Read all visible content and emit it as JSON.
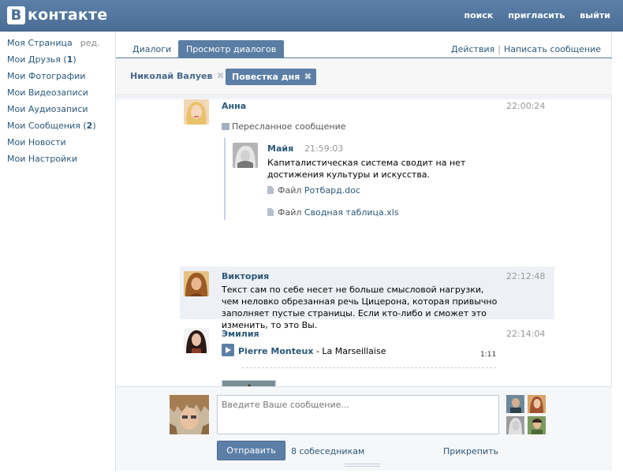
{
  "header": {
    "logo_letter": "В",
    "logo_text": "контакте",
    "links": [
      "поиск",
      "пригласить",
      "выйти"
    ]
  },
  "menu": {
    "items": [
      {
        "label": "Моя Страница",
        "extra": "ред."
      },
      {
        "label": "Мои Друзья (",
        "count": "1",
        "suffix": ")"
      },
      {
        "label": "Мои Фотографии"
      },
      {
        "label": "Мои Видеозаписи"
      },
      {
        "label": "Мои Аудиозаписи"
      },
      {
        "label": "Мои Сообщения (",
        "count": "2",
        "suffix": ")"
      },
      {
        "label": "Мои Новости"
      },
      {
        "label": "Мои Настройки"
      }
    ]
  },
  "tabs": [
    {
      "label": "Диалоги"
    },
    {
      "label": "Просмотр диалогов"
    }
  ],
  "actions": {
    "actions": "Действия",
    "write": "Написать сообщение"
  },
  "chips": [
    {
      "label": "Николай Валуев"
    },
    {
      "label": "Повестка дня"
    }
  ],
  "messages": {
    "anna": {
      "author": "Анна",
      "time": "22:00:24",
      "forward_label": "Пересланное сообщение",
      "fwd": {
        "author": "Майя",
        "time": "21:59:03",
        "text": "Капиталистическая система сводит на нет достижения культуры и искусства.",
        "file1_prefix": "Файл ",
        "file1_name": "Ротбард.doc",
        "file2_prefix": "Файл ",
        "file2_name": "Сводная таблица.xls"
      }
    },
    "viktoria": {
      "author": "Виктория",
      "time": "22:12:48",
      "text": "Текст сам по себе несет не больше смысловой нагрузки, чем неловко обрезанная речь Цицерона, которая привычно заполняет пустые страницы. Если кто-либо и сможет это изменить, то это Вы."
    },
    "emilia": {
      "author": "Эмилия",
      "time": "22:14:04",
      "audio_artist": "Pierre Monteux",
      "audio_sep": " - ",
      "audio_title": "La Marseillaise",
      "audio_duration": "1:11"
    }
  },
  "reply": {
    "placeholder": "Введите Ваше сообщение...",
    "send": "Отправить",
    "partners": "8 собеседникам",
    "attach": "Прикрепить"
  }
}
